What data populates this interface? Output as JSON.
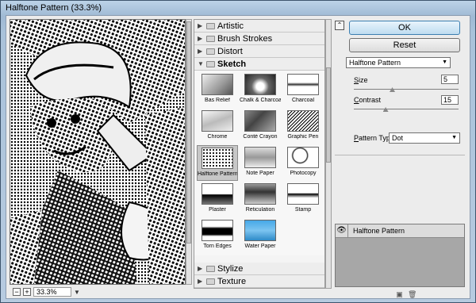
{
  "window": {
    "title": "Halftone Pattern (33.3%)"
  },
  "preview": {
    "zoom": "33.3%",
    "zoom_out": "−",
    "zoom_in": "+",
    "zoom_menu": "▼"
  },
  "gallery": {
    "collapsed_arrow": "▶",
    "expanded_arrow": "▼",
    "folders_top": [
      {
        "label": "Artistic"
      },
      {
        "label": "Brush Strokes"
      },
      {
        "label": "Distort"
      }
    ],
    "open_folder": {
      "label": "Sketch"
    },
    "filters": [
      {
        "label": "Bas Relief"
      },
      {
        "label": "Chalk & Charcoal"
      },
      {
        "label": "Charcoal"
      },
      {
        "label": "Chrome"
      },
      {
        "label": "Conté Crayon"
      },
      {
        "label": "Graphic Pen"
      },
      {
        "label": "Halftone Pattern"
      },
      {
        "label": "Note Paper"
      },
      {
        "label": "Photocopy"
      },
      {
        "label": "Plaster"
      },
      {
        "label": "Reticulation"
      },
      {
        "label": "Stamp"
      },
      {
        "label": "Torn Edges"
      },
      {
        "label": "Water Paper"
      }
    ],
    "selected_filter": "Halftone Pattern",
    "folders_bottom": [
      {
        "label": "Stylize"
      },
      {
        "label": "Texture"
      }
    ]
  },
  "panel": {
    "collapse_icon": "⌃",
    "ok_label": "OK",
    "reset_label": "Reset",
    "filter_select": "Halftone Pattern",
    "select_arrow": "▼",
    "size_label_u": "S",
    "size_label_rest": "ize",
    "size_value": "5",
    "size_range": [
      1,
      12
    ],
    "contrast_label_u": "C",
    "contrast_label_rest": "ontrast",
    "contrast_value": "15",
    "contrast_range": [
      0,
      50
    ],
    "pattern_label_u": "P",
    "pattern_label_rest": "attern Type:",
    "pattern_value": "Dot"
  },
  "layers": {
    "eye_icon": "👁",
    "items": [
      {
        "name": "Halftone Pattern"
      }
    ],
    "new_layer_icon": "▣",
    "delete_icon": "🗑"
  },
  "colors": {
    "title_bar": "#a9c2da",
    "dialog_bg": "#ececec",
    "ok_button": "#bedcf0",
    "selected_thumb": "#c7c7c7"
  }
}
